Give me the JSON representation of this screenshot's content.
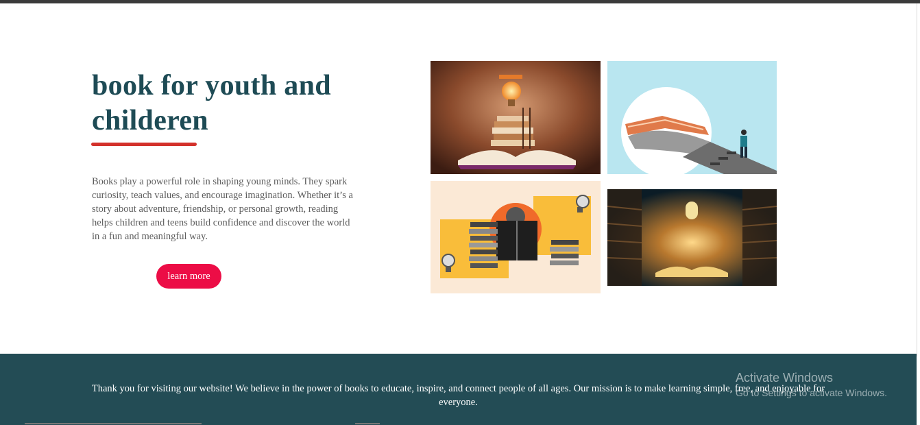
{
  "hero": {
    "title": "book for youth and childeren",
    "description": "Books play a powerful role in shaping young minds. They spark curiosity, teach values, and encourage imagination. Whether it’s a story about adventure, friendship, or personal growth, reading helps children and teens build confidence and discover the world in a fun and meaningful way.",
    "button_label": "learn more"
  },
  "footer": {
    "text": "Thank you for visiting our website! We believe in the power of books to educate, inspire, and connect people of all ages. Our mission is to make learning simple, free, and enjoyable for everyone."
  },
  "os_watermark": {
    "title": "Activate Windows",
    "subtitle": "Go to Settings to activate Windows."
  },
  "colors": {
    "title": "#1e4b55",
    "accent_underline": "#d3312b",
    "button": "#ec0d46",
    "footer_bg": "#234c55"
  }
}
